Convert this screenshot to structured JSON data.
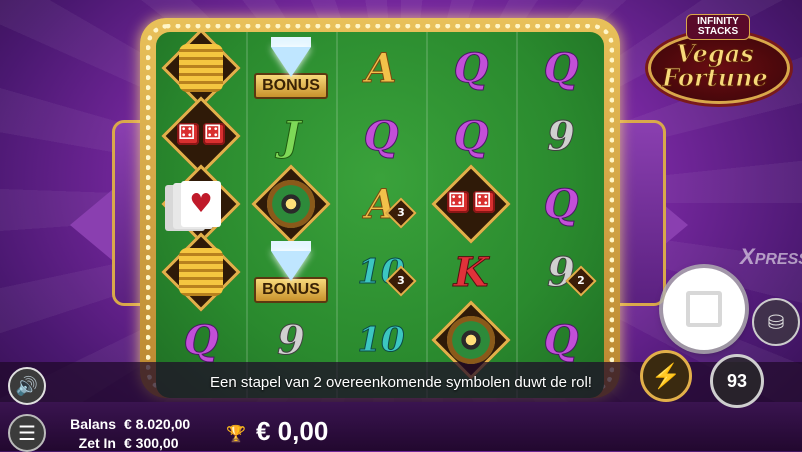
{
  "game": {
    "logo_top": "INFINITY STACKS",
    "logo_main": "Vegas Fortune"
  },
  "reels": [
    [
      {
        "symbol": "coins",
        "icon": "coins-icon"
      },
      {
        "symbol": "dice",
        "icon": "dice-icon"
      },
      {
        "symbol": "cards",
        "icon": "playing-cards-icon",
        "glyph": "♥"
      },
      {
        "symbol": "coins",
        "icon": "coins-icon"
      },
      {
        "symbol": "Q",
        "glyph": "Q"
      }
    ],
    [
      {
        "symbol": "bonus",
        "glyph": "BONUS"
      },
      {
        "symbol": "J",
        "glyph": "J"
      },
      {
        "symbol": "roulette",
        "icon": "roulette-wheel-icon"
      },
      {
        "symbol": "bonus",
        "glyph": "BONUS"
      },
      {
        "symbol": "9",
        "glyph": "9"
      }
    ],
    [
      {
        "symbol": "A",
        "glyph": "A"
      },
      {
        "symbol": "Q",
        "glyph": "Q"
      },
      {
        "symbol": "A",
        "glyph": "A",
        "stack": "3"
      },
      {
        "symbol": "10",
        "glyph": "10",
        "stack": "3"
      },
      {
        "symbol": "10",
        "glyph": "10"
      }
    ],
    [
      {
        "symbol": "Q",
        "glyph": "Q"
      },
      {
        "symbol": "Q",
        "glyph": "Q"
      },
      {
        "symbol": "dice",
        "icon": "dice-icon"
      },
      {
        "symbol": "K",
        "glyph": "K"
      },
      {
        "symbol": "roulette",
        "icon": "roulette-wheel-icon"
      }
    ],
    [
      {
        "symbol": "Q",
        "glyph": "Q"
      },
      {
        "symbol": "9",
        "glyph": "9"
      },
      {
        "symbol": "Q",
        "glyph": "Q"
      },
      {
        "symbol": "9",
        "glyph": "9",
        "stack": "2"
      },
      {
        "symbol": "Q",
        "glyph": "Q"
      }
    ]
  ],
  "message": "Een stapel van 2 overeenkomende symbolen duwt de rol!",
  "balance": {
    "label": "Balans",
    "value": "€ 8.020,00"
  },
  "bet": {
    "label": "Zet In",
    "value": "€ 300,00"
  },
  "win": {
    "value": "€ 0,00",
    "icon": "trophy-icon"
  },
  "controls": {
    "xpress_x": "X",
    "xpress_label": "PRESS",
    "autoplay_count": "93",
    "sound_icon": "speaker-icon",
    "menu_icon": "hamburger-menu-icon",
    "spin_icon": "stop-icon",
    "turbo_icon": "lightning-icon",
    "coin_icon": "coin-stack-icon"
  }
}
